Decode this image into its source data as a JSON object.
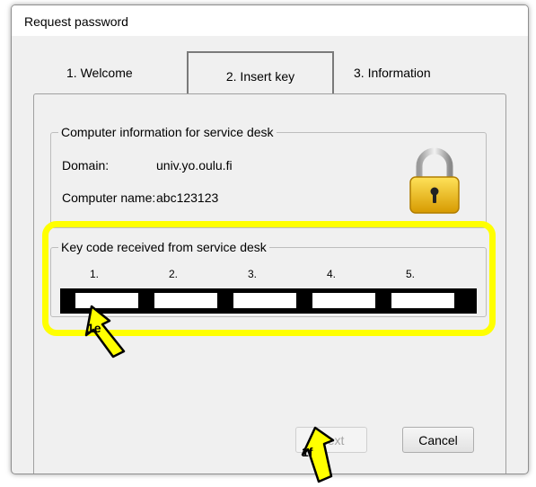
{
  "window": {
    "title": "Request password"
  },
  "tabs": [
    {
      "label": "1. Welcome"
    },
    {
      "label": "2. Insert key"
    },
    {
      "label": "3. Information"
    }
  ],
  "computer_info": {
    "legend": "Computer information for service desk",
    "domain_label": "Domain:",
    "domain_value": "univ.yo.oulu.fi",
    "computer_name_label": "Computer name:",
    "computer_name_value": "abc123123"
  },
  "key_code": {
    "legend": "Key code received from service desk",
    "columns": [
      "1.",
      "2.",
      "3.",
      "4.",
      "5."
    ],
    "values": [
      "",
      "",
      "",
      "",
      ""
    ]
  },
  "buttons": {
    "next": "Next",
    "cancel": "Cancel"
  },
  "callouts": {
    "key_fields": "1e",
    "next_button": "1f"
  },
  "colors": {
    "highlight": "#ffff00",
    "lock_body": "#f2c200",
    "disabled_text": "#a6a6a6"
  },
  "icons": {
    "lock": "padlock-icon"
  }
}
